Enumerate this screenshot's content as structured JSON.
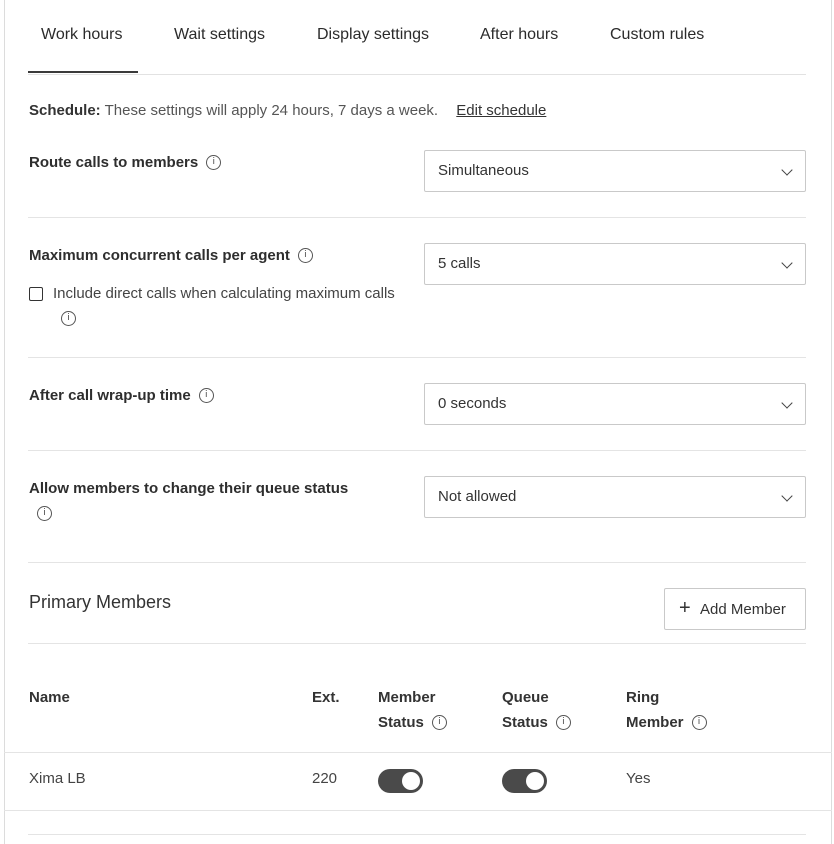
{
  "tabs": [
    {
      "label": "Work hours",
      "active": true
    },
    {
      "label": "Wait settings"
    },
    {
      "label": "Display settings"
    },
    {
      "label": "After hours"
    },
    {
      "label": "Custom rules"
    }
  ],
  "schedule": {
    "prefix": "Schedule:",
    "text": "These settings will apply 24 hours, 7 days a week.",
    "link": "Edit schedule"
  },
  "settings": {
    "route_calls": {
      "label": "Route calls to members",
      "value": "Simultaneous"
    },
    "max_concurrent": {
      "label": "Maximum concurrent calls per agent",
      "value": "5 calls",
      "checkbox_label": "Include direct calls when calculating maximum calls",
      "checked": false
    },
    "wrap_up": {
      "label": "After call wrap-up time",
      "value": "0 seconds"
    },
    "queue_status": {
      "label": "Allow members to change their queue status",
      "value": "Not allowed"
    }
  },
  "members": {
    "title": "Primary Members",
    "add_button": "Add Member",
    "columns": {
      "name": "Name",
      "ext": "Ext.",
      "member_status_1": "Member",
      "member_status_2": "Status",
      "queue_status_1": "Queue",
      "queue_status_2": "Status",
      "ring_member_1": "Ring",
      "ring_member_2": "Member"
    },
    "rows": [
      {
        "name": "Xima LB",
        "ext": "220",
        "member_status": true,
        "queue_status": true,
        "ring_member": "Yes"
      }
    ]
  },
  "icons": {
    "info": "info-icon",
    "chevron": "chevron-down-icon",
    "plus": "plus-icon"
  },
  "colors": {
    "toggle_on": "#4a4a4a",
    "border": "#c9c9c9",
    "divider": "#e4e4e4"
  }
}
